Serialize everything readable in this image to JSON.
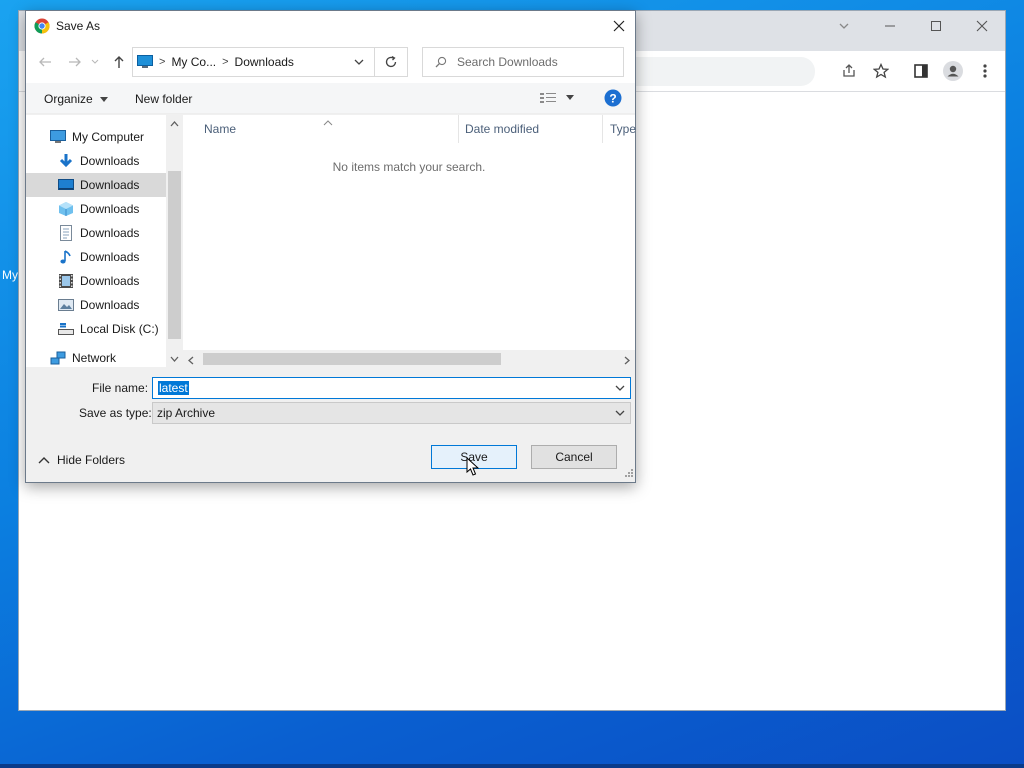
{
  "desktop": {
    "partial_label": "My"
  },
  "browser": {
    "window_title": ""
  },
  "dialog": {
    "title": "Save As",
    "breadcrumb": [
      "My Co...",
      "Downloads"
    ],
    "search_placeholder": "Search Downloads",
    "toolbar": {
      "organize": "Organize",
      "new_folder": "New folder"
    },
    "tree": [
      {
        "label": "My Computer",
        "icon": "computer-icon",
        "level": 0,
        "selected": false
      },
      {
        "label": "Downloads",
        "icon": "download-arrow-icon",
        "level": 1,
        "selected": false
      },
      {
        "label": "Downloads",
        "icon": "desktop-icon",
        "level": 1,
        "selected": true
      },
      {
        "label": "Downloads",
        "icon": "3d-objects-icon",
        "level": 1,
        "selected": false
      },
      {
        "label": "Downloads",
        "icon": "document-icon",
        "level": 1,
        "selected": false
      },
      {
        "label": "Downloads",
        "icon": "music-icon",
        "level": 1,
        "selected": false
      },
      {
        "label": "Downloads",
        "icon": "video-icon",
        "level": 1,
        "selected": false
      },
      {
        "label": "Downloads",
        "icon": "picture-icon",
        "level": 1,
        "selected": false
      },
      {
        "label": "Local Disk (C:)",
        "icon": "drive-icon",
        "level": 1,
        "selected": false
      },
      {
        "label": "Network",
        "icon": "network-icon",
        "level": 0,
        "selected": false
      }
    ],
    "columns": [
      "Name",
      "Date modified",
      "Type"
    ],
    "empty_message": "No items match your search.",
    "file_name_label": "File name:",
    "file_name_value": "latest",
    "save_type_label": "Save as type:",
    "save_type_value": "zip Archive",
    "hide_folders": "Hide Folders",
    "save_button": "Save",
    "cancel_button": "Cancel"
  },
  "colors": {
    "accent": "#0078d7",
    "selected_tree": "#d9d9d9",
    "desktop": "#0b7fe0"
  }
}
